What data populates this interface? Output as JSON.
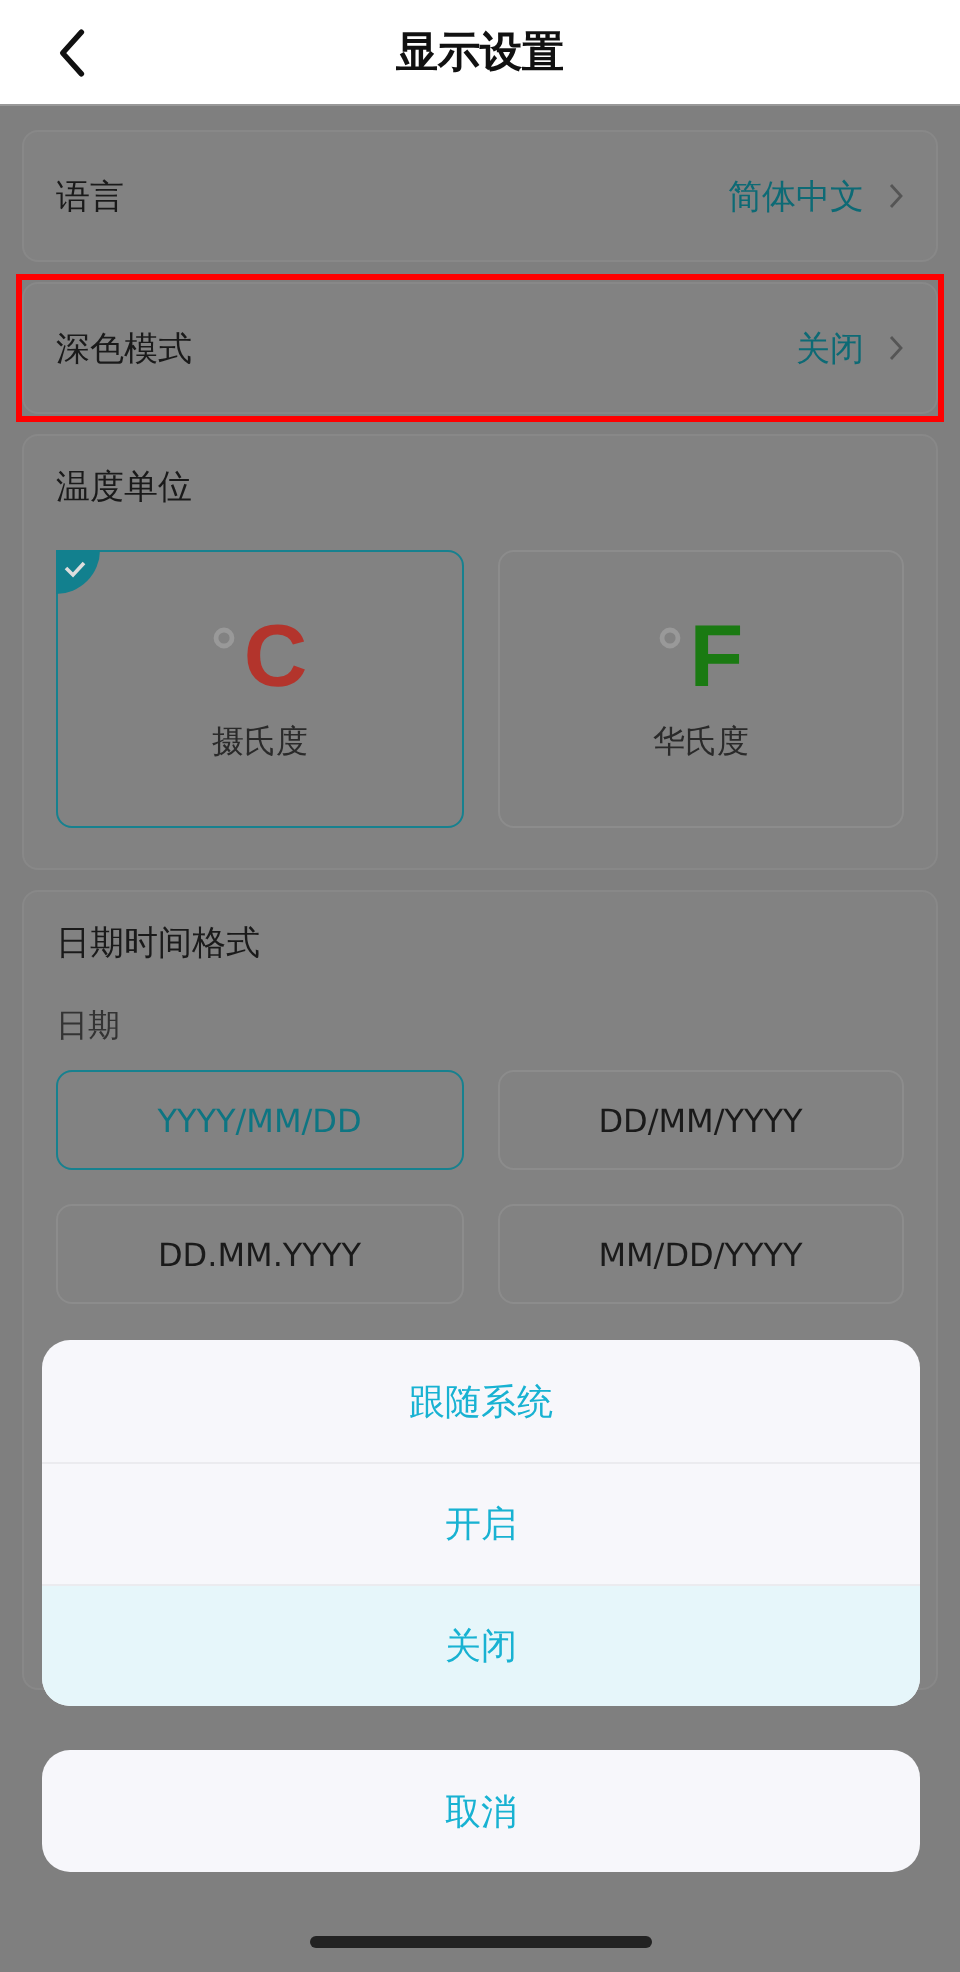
{
  "header": {
    "title": "显示设置"
  },
  "settings": [
    {
      "label": "语言",
      "value": "简体中文",
      "highlighted": false
    },
    {
      "label": "深色模式",
      "value": "关闭",
      "highlighted": true
    }
  ],
  "temperature": {
    "title": "温度单位",
    "options": [
      {
        "symbol": "C",
        "label": "摄氏度",
        "color": "#b3342c",
        "selected": true
      },
      {
        "symbol": "F",
        "label": "华氏度",
        "color": "#1a7a12",
        "selected": false
      }
    ]
  },
  "datetime": {
    "title": "日期时间格式",
    "subtitle": "日期",
    "options": [
      {
        "label": "YYYY/MM/DD",
        "selected": true
      },
      {
        "label": "DD/MM/YYYY",
        "selected": false
      },
      {
        "label": "DD.MM.YYYY",
        "selected": false
      },
      {
        "label": "MM/DD/YYYY",
        "selected": false
      }
    ]
  },
  "action_sheet": {
    "options": [
      {
        "label": "跟随系统",
        "selected": false
      },
      {
        "label": "开启",
        "selected": false
      },
      {
        "label": "关闭",
        "selected": true
      }
    ],
    "cancel": "取消"
  }
}
